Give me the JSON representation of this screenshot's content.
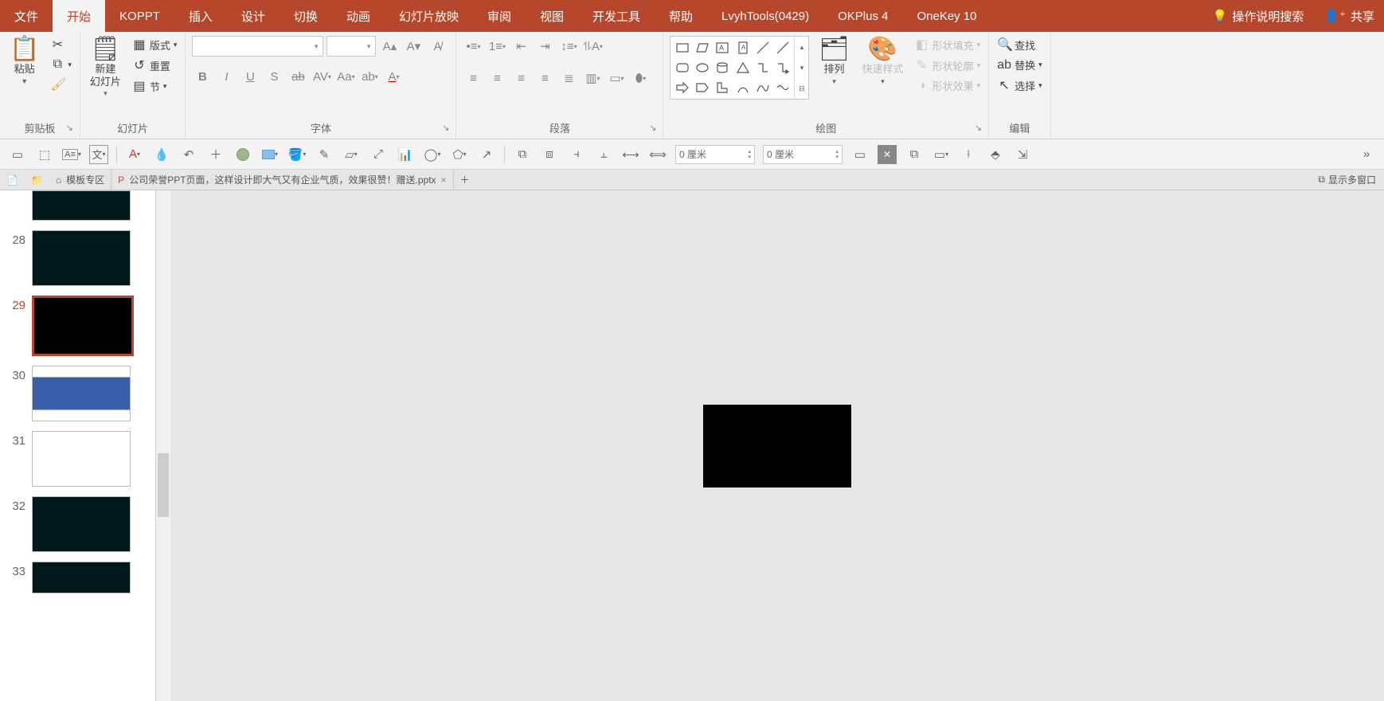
{
  "tabs": {
    "file": "文件",
    "home": "开始",
    "koppt": "KOPPT",
    "insert": "插入",
    "design": "设计",
    "transition": "切换",
    "animation": "动画",
    "slideshow": "幻灯片放映",
    "review": "审阅",
    "view": "视图",
    "dev": "开发工具",
    "help": "帮助",
    "lvyh": "LvyhTools(0429)",
    "okplus": "OKPlus 4",
    "onekey": "OneKey 10",
    "tellme": "操作说明搜索",
    "share": "共享"
  },
  "groups": {
    "clipboard": {
      "label": "剪贴板",
      "paste": "粘贴",
      "cut": "剪切",
      "copy": "复制",
      "format_painter": "格式刷"
    },
    "slides": {
      "label": "幻灯片",
      "new_slide": "新建\n幻灯片",
      "layout": "版式",
      "reset": "重置",
      "section": "节"
    },
    "font": {
      "label": "字体"
    },
    "paragraph": {
      "label": "段落"
    },
    "drawing": {
      "label": "绘图",
      "arrange": "排列",
      "quick_style": "快速样式",
      "fill": "形状填充",
      "outline": "形状轮廓",
      "effects": "形状效果"
    },
    "editing": {
      "label": "编辑",
      "find": "查找",
      "replace": "替换",
      "select": "选择"
    }
  },
  "toolbar2": {
    "size1": "0 厘米",
    "size2": "0 厘米",
    "text_box": "文"
  },
  "doc_tabs": {
    "template_zone": "模板专区",
    "file_name": "公司荣誉PPT页面，这样设计即大气又有企业气质，效果很赞！赠送.pptx",
    "multi_window": "显示多窗口"
  },
  "thumbs": {
    "n28": "28",
    "n29": "29",
    "n30": "30",
    "n31": "31",
    "n32": "32",
    "n33": "33"
  }
}
